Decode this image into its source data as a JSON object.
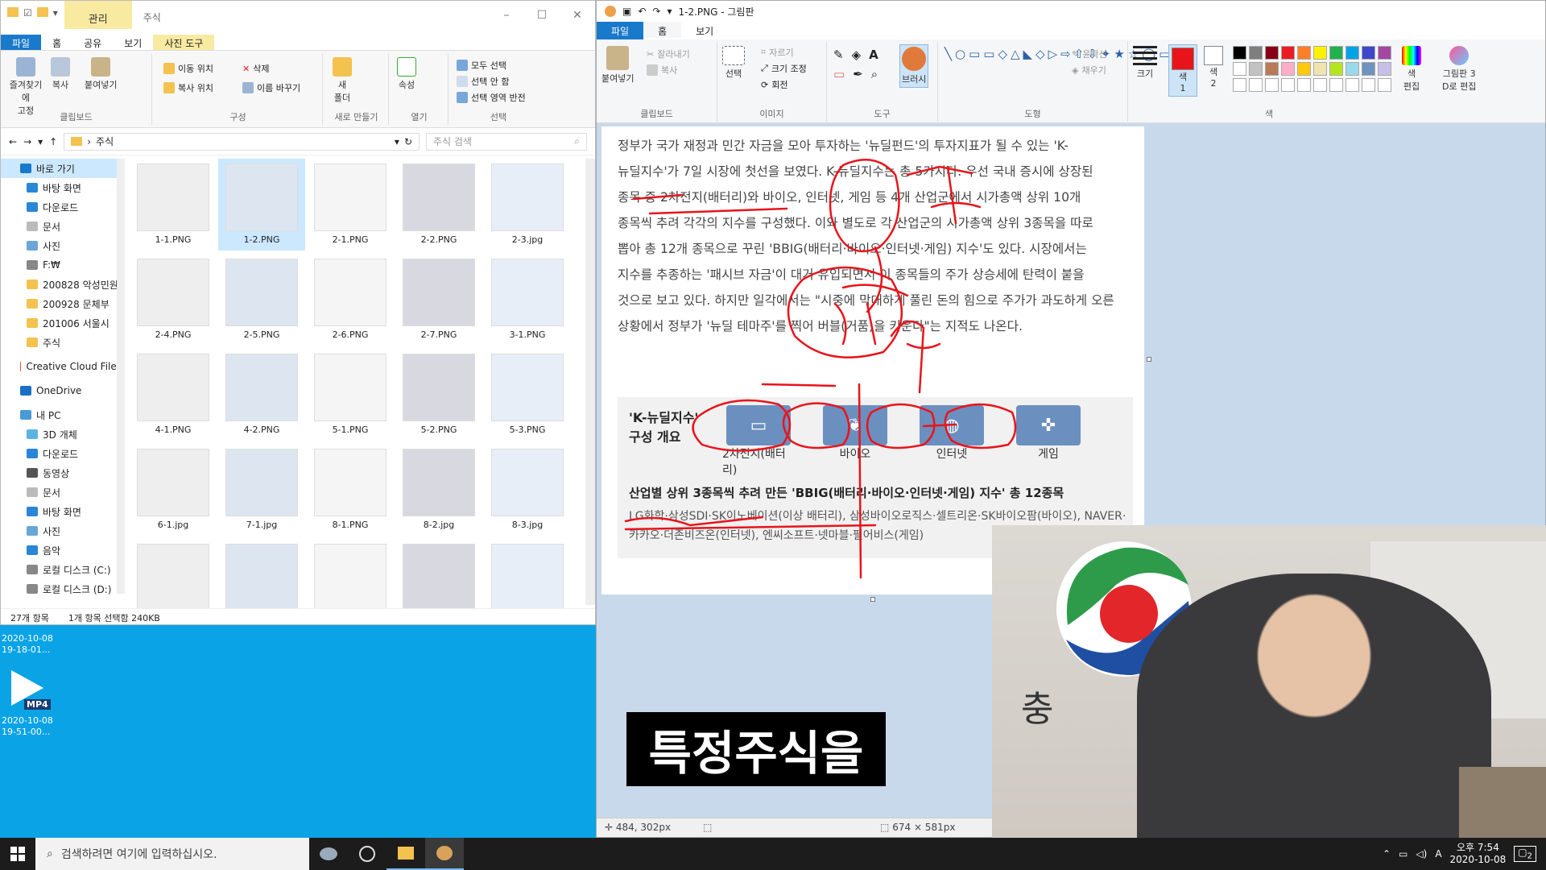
{
  "explorer": {
    "quick_access_title": "주식",
    "context_tab": "관리",
    "tabs": [
      "파일",
      "홈",
      "공유",
      "보기",
      "사진 도구"
    ],
    "ribbon": {
      "pin": "즐겨찾기에\n고정",
      "copy": "복사",
      "paste": "붙여넣기",
      "move_to": "이동 위치",
      "copy_to": "복사 위치",
      "delete": "삭제",
      "rename": "이름 바꾸기",
      "new_folder": "새\n폴더",
      "properties": "속성",
      "select_all": "모두 선택",
      "select_none": "선택 안 함",
      "invert": "선택 영역 반전",
      "groups": [
        "클립보드",
        "구성",
        "새로 만들기",
        "열기",
        "선택"
      ]
    },
    "address": "주식",
    "search_placeholder": "주식 검색",
    "nav": [
      "바로 가기",
      "바탕 화면",
      "다운로드",
      "문서",
      "사진",
      "F:₩",
      "200828 악성민원",
      "200928 문체부",
      "201006 서울시",
      "주식",
      "Creative Cloud Files",
      "OneDrive",
      "내 PC",
      "3D 개체",
      "다운로드",
      "동영상",
      "문서",
      "바탕 화면",
      "사진",
      "음악",
      "로컬 디스크 (C:)",
      "로컬 디스크 (D:)"
    ],
    "files": [
      "1-1.PNG",
      "1-2.PNG",
      "2-1.PNG",
      "2-2.PNG",
      "2-3.jpg",
      "2-4.PNG",
      "2-5.PNG",
      "2-6.PNG",
      "2-7.PNG",
      "3-1.PNG",
      "4-1.PNG",
      "4-2.PNG",
      "5-1.PNG",
      "5-2.PNG",
      "5-3.PNG",
      "6-1.jpg",
      "7-1.jpg",
      "8-1.PNG",
      "8-2.jpg",
      "8-3.jpg",
      "",
      "",
      "",
      "",
      ""
    ],
    "status_count": "27개 항목",
    "status_selected": "1개 항목 선택함 240KB"
  },
  "desktop": {
    "item1_time": "2020-10-08\n19-18-01...",
    "item2_label": "MP4",
    "item2_time": "2020-10-08\n19-51-00..."
  },
  "paint": {
    "title": "1-2.PNG - 그림판",
    "tabs": [
      "파일",
      "홈",
      "보기"
    ],
    "ribbon": {
      "paste": "붙여넣기",
      "cut": "잘라내기",
      "copy": "복사",
      "select": "선택",
      "crop": "자르기",
      "resize": "크기 조정",
      "rotate": "회전",
      "brush": "브러시",
      "outline": "윤곽선",
      "fill": "채우기",
      "size": "크기",
      "color1": "색\n1",
      "color2": "색\n2",
      "edit_colors": "색\n편집",
      "paint3d": "그림판 3\nD로 편집",
      "groups": [
        "클립보드",
        "이미지",
        "도구",
        "도형",
        "색"
      ]
    },
    "status_pos": "484, 302px",
    "status_size": "674 × 581px"
  },
  "article": {
    "body": "정부가 국가 재정과 민간 자금을 모아 투자하는 '뉴딜펀드'의 투자지표가 될 수 있는 'K-뉴딜지수'가 7일 시장에 첫선을 보였다. K-뉴딜지수는 총 5가지다. 우선 국내 증시에 상장된 종목 중 2차전지(배터리)와 바이오, 인터넷, 게임 등 4개 산업군에서 시가총액 상위 10개 종목씩 추려 각각의 지수를 구성했다. 이와 별도로 각 산업군의 시가총액 상위 3종목을 따로 뽑아 총 12개 종목으로 꾸린 'BBIG(배터리·바이오·인터넷·게임) 지수'도 있다. 시장에서는 지수를 추종하는 '패시브 자금'이 대거 유입되면서 이 종목들의 주가 상승세에 탄력이 붙을 것으로 보고 있다. 하지만 일각에서는 \"시중에 막대하게 풀린 돈의 힘으로 주가가 과도하게 오른 상황에서 정부가 '뉴딜 테마주'를 찍어 버블(거품)을 키운다\"는 지적도 나온다.",
    "box_title": "'K-뉴딜지수'\n구성 개요",
    "icons": [
      "2차전지(배터리)",
      "바이오",
      "인터넷",
      "게임"
    ],
    "summary": "산업별 상위 3종목씩 추려 만든 'BBIG(배터리·바이오·인터넷·게임) 지수' 총 12종목",
    "companies": "LG화학·삼성SDI·SK이노베이션(이상 배터리), 삼성바이오로직스·셀트리온·SK바이오팜(바이오), NAVER·카카오·더존비즈온(인터넷), 엔씨소프트·넷마블·펄어비스(게임)"
  },
  "webcam": {
    "emblem_text": "충  주"
  },
  "caption": "특정주식을",
  "taskbar": {
    "search_placeholder": "검색하려면 여기에 입력하십시오.",
    "time": "오후 7:54",
    "date": "2020-10-08",
    "notif": "2",
    "ime": "A"
  },
  "colors": {
    "accent": "#1979ca",
    "annotation": "#e8141b"
  }
}
